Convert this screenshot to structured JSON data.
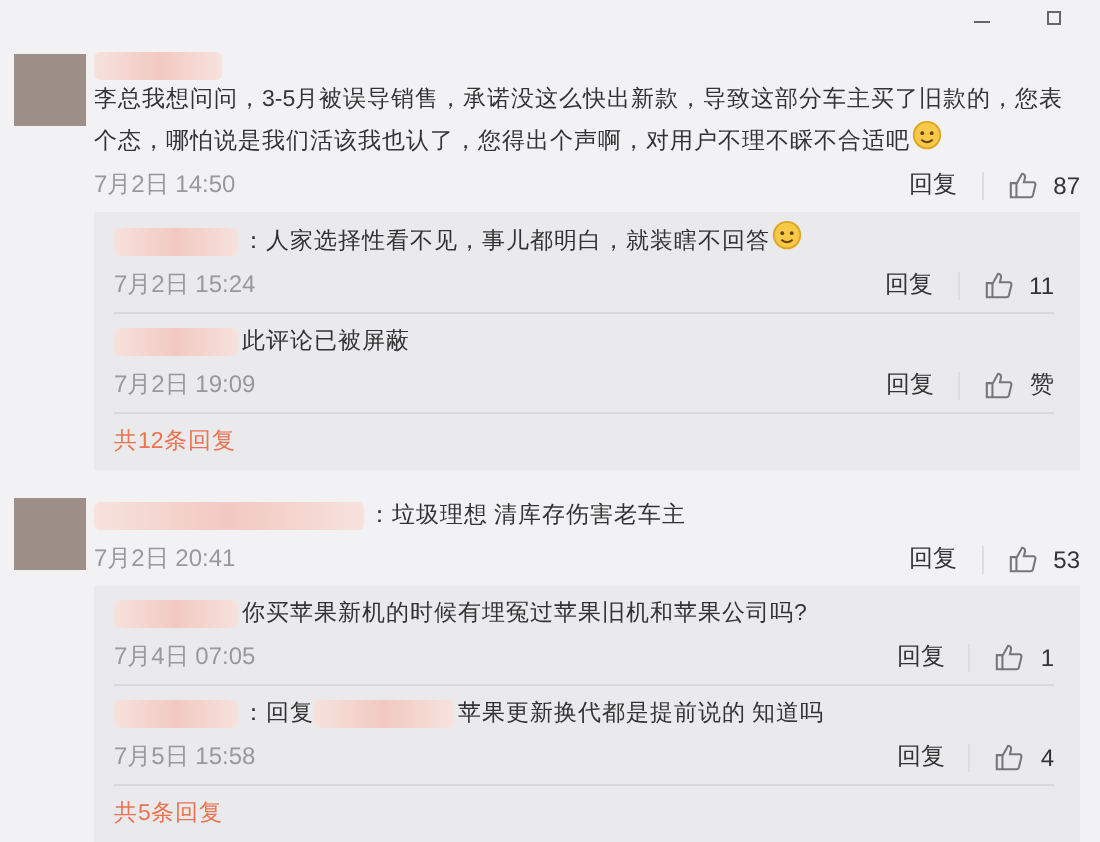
{
  "comments": [
    {
      "kind": "plain",
      "text": "李总我想问问，3-5月被误导销售，承诺没这么快出新款，导致这部分车主买了旧款的，您表个态，哪怕说是我们活该我也认了，您得出个声啊，对用户不理不睬不合适吧",
      "emoji": true,
      "time": "7月2日 14:50",
      "reply_label": "回复",
      "likes": "87",
      "replies": [
        {
          "kind": "plain",
          "text": "：人家选择性看不见，事儿都明白，就装瞎不回答",
          "emoji": true,
          "time": "7月2日 15:24",
          "reply_label": "回复",
          "likes": "11"
        },
        {
          "kind": "plain",
          "text": "此评论已被屏蔽",
          "emoji": false,
          "time": "7月2日 19:09",
          "reply_label": "回复",
          "likes": "赞"
        }
      ],
      "more": "共12条回复"
    },
    {
      "kind": "plain",
      "text": "：垃圾理想 清库存伤害老车主",
      "emoji": false,
      "time": "7月2日 20:41",
      "reply_label": "回复",
      "likes": "53",
      "replies": [
        {
          "kind": "plain",
          "text": "你买苹果新机的时候有埋冤过苹果旧机和苹果公司吗?",
          "emoji": false,
          "time": "7月4日 07:05",
          "reply_label": "回复",
          "likes": "1"
        },
        {
          "kind": "reply_to",
          "text_before": "：回复",
          "text": "苹果更新换代都是提前说的 知道吗",
          "emoji": false,
          "time": "7月5日 15:58",
          "reply_label": "回复",
          "likes": "4"
        }
      ],
      "more": "共5条回复"
    }
  ]
}
